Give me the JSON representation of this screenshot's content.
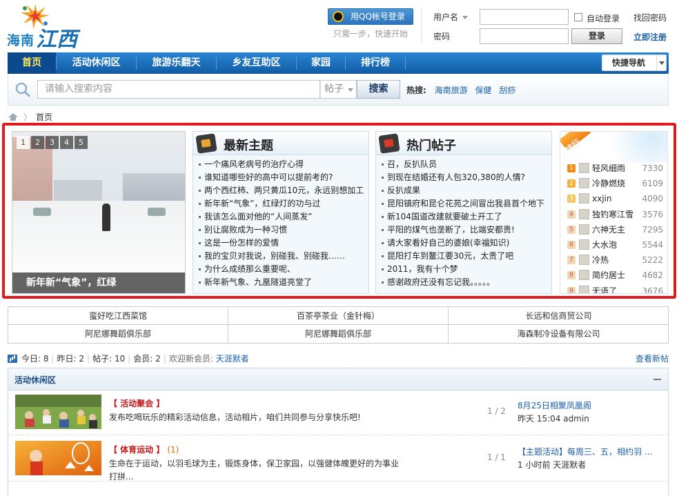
{
  "header": {
    "logo_text_1": "海南",
    "logo_text_2": "江西人",
    "qq_login": "用QQ帐号登录",
    "qq_hint": "只需一步，快速开始",
    "username_label": "用户名",
    "password_label": "密码",
    "auto_login": "自动登录",
    "forgot_password": "找回密码",
    "login_button": "登录",
    "register_link": "立即注册"
  },
  "nav": {
    "items": [
      "首页",
      "活动休闲区",
      "旅游乐翻天",
      "乡友互助区",
      "家园",
      "排行榜"
    ],
    "quick_nav": "快捷导航"
  },
  "search": {
    "placeholder": "请输入搜索内容",
    "type": "帖子",
    "button": "搜索",
    "hot_label": "热搜:",
    "hot_terms": [
      "海南旅游",
      "保健",
      "刮痧"
    ]
  },
  "breadcrumb": {
    "current": "首页"
  },
  "slideshow": {
    "pages": [
      "1",
      "2",
      "3",
      "4",
      "5"
    ],
    "caption": "新年新“气象”，红绿"
  },
  "latest": {
    "title": "最新主题",
    "items": [
      "一个痛风老病号的治疗心得",
      "谁知道哪些好的高中可以提前考的?",
      "两个西红柿、两只黄瓜10元，永远别想加工",
      "新年新“气象”，红绿灯的功与过",
      "我该怎么面对他的“人间蒸发”",
      "别让腐败成为一种习惯",
      "这是一份怎样的爱情",
      "我的宝贝对我说，别碰我、别碰我……",
      "为什么成绩那么重要呢、",
      "新年新气象、九凰隧道亮堂了"
    ]
  },
  "hot": {
    "title": "热门帖子",
    "items": [
      "召，反扒队员",
      "到现在结婚还有人包320,380的人情?",
      "反扒成果",
      "昆阳镇府和昆仑花苑之间冒出我县首个地下",
      "新104国道改建就要破土开工了",
      "平阳的煤气也垄断了，比端安都贵!",
      "请大家看好自己的婆娘(幸福知识)",
      "昆阳打车到鳌江要30元，太贵了吧",
      "2011，我有十个梦",
      "感谢政府还没有忘记我。。。。。"
    ]
  },
  "ranking": {
    "badge": "排行",
    "items": [
      {
        "rank": "1",
        "name": "轻风细雨",
        "score": "7330"
      },
      {
        "rank": "2",
        "name": "冷静燃烧",
        "score": "6109"
      },
      {
        "rank": "3",
        "name": "xxjin",
        "score": "4090"
      },
      {
        "rank": "4",
        "name": "独钓寒江雪",
        "score": "3576"
      },
      {
        "rank": "5",
        "name": "六神无主",
        "score": "7295"
      },
      {
        "rank": "6",
        "name": "大水泡",
        "score": "5544"
      },
      {
        "rank": "7",
        "name": "冷热",
        "score": "5222"
      },
      {
        "rank": "8",
        "name": "简约居士",
        "score": "4682"
      },
      {
        "rank": "9",
        "name": "无语了",
        "score": "3676"
      }
    ]
  },
  "links": [
    "蛮好吃江西菜馆",
    "百茶亭茶业（金针梅）",
    "长远和信商贸公司",
    "阿尼娜舞蹈俱乐部",
    "阿尼娜舞蹈俱乐部",
    "海森制冷设备有限公司"
  ],
  "stats": {
    "today": "今日: 8",
    "yesterday": "昨日: 2",
    "posts": "帖子: 10",
    "members": "会员: 2",
    "welcome": "欢迎新会员:",
    "new_member": "天涯默者",
    "view_new": "查看新帖"
  },
  "forum": {
    "title": "活动休闲区",
    "rows": [
      {
        "name": "【 活动聚会 】",
        "count": "",
        "desc": "发布吃喝玩乐的精彩活动信息，活动相片，咱们共同参与分享快乐吧!",
        "ratio": "1 / 2",
        "last_title": "8月25日相聚凤凰阁",
        "last_meta": "昨天 15:04 admin"
      },
      {
        "name": "【 体育运动 】",
        "count": "(1)",
        "desc": "生命在于运动，以羽毛球为主，锻炼身体，保卫家园，以强健体魄更好的为事业打拼...",
        "ratio": "1 / 1",
        "last_title": "【主题活动】每周三、五，相约羽 ...",
        "last_meta": "1 小时前 天涯默者"
      }
    ]
  },
  "colors": {
    "nav_blue": "#1a6fc0",
    "highlight_border": "#e11b1b",
    "link_blue": "#1a5fa8",
    "forum_red": "#c41a1a"
  }
}
